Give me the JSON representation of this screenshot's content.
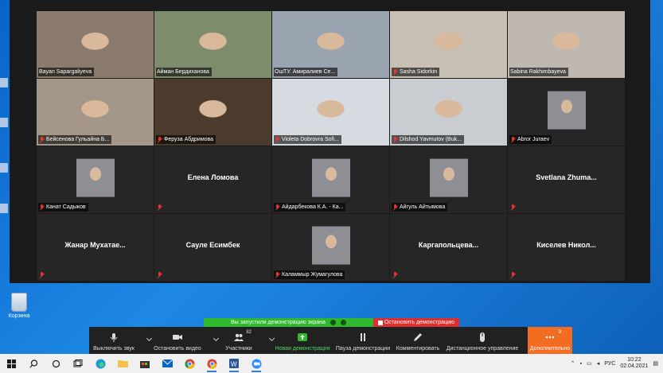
{
  "participants": [
    {
      "name": "Bayan Sapargaliyeva",
      "video": true,
      "muted": false,
      "active": true,
      "bg": "#8a7b6c"
    },
    {
      "name": "Айман Бердиханова",
      "video": true,
      "muted": false,
      "active": false,
      "bg": "#7d8c6a"
    },
    {
      "name": "OшТУ. Амиралиев Се...",
      "video": true,
      "muted": false,
      "active": false,
      "bg": "#9aa3b0"
    },
    {
      "name": "Sasha Sidorkin",
      "video": true,
      "muted": true,
      "active": false,
      "bg": "#c8c0b4"
    },
    {
      "name": "Sabina Rakhimbayeva",
      "video": true,
      "muted": false,
      "active": false,
      "bg": "#bfb8b0"
    },
    {
      "name": "Бейсенова Гульайна Б...",
      "video": true,
      "muted": true,
      "active": false,
      "bg": "#a49688"
    },
    {
      "name": "Феруза Абдримова",
      "video": true,
      "muted": true,
      "active": false,
      "bg": "#4a3b2c"
    },
    {
      "name": "Violeta Dobrovra Sofi...",
      "video": true,
      "muted": true,
      "active": false,
      "bg": "#d6dbe2"
    },
    {
      "name": "Dilshod Yavmutov (Buk...",
      "video": true,
      "muted": true,
      "active": false,
      "bg": "#c9ccd1"
    },
    {
      "name": "Abror Juraev",
      "video": true,
      "muted": true,
      "active": false,
      "bg": "#262626",
      "thumb": true
    },
    {
      "name": "Канат Садыков",
      "video": true,
      "muted": true,
      "active": false,
      "bg": "#262626",
      "thumb": true
    },
    {
      "name": "Елена Ломова",
      "video": false,
      "muted": true,
      "active": false
    },
    {
      "name": "Айдарбекова К.А. - Ка...",
      "video": true,
      "muted": true,
      "active": false,
      "bg": "#262626",
      "thumb": true
    },
    {
      "name": "Айгуль Айтымова",
      "video": true,
      "muted": true,
      "active": false,
      "bg": "#262626",
      "thumb": true
    },
    {
      "name": "Svetlana  Zhuma...",
      "video": false,
      "muted": true,
      "active": false
    },
    {
      "name": "Жанар  Мухатае...",
      "video": false,
      "muted": true,
      "active": false
    },
    {
      "name": "Сауле Есимбек",
      "video": false,
      "muted": true,
      "active": false
    },
    {
      "name": "Каламмыр Жумагулова",
      "video": true,
      "muted": true,
      "active": false,
      "bg": "#262626",
      "thumb": true
    },
    {
      "name": "Каргапольцева...",
      "video": false,
      "muted": true,
      "active": false
    },
    {
      "name": "Киселев  Никол...",
      "video": false,
      "muted": true,
      "active": false
    }
  ],
  "desktop": {
    "recycle_label": "Корзина"
  },
  "share_banner": {
    "status_text": "Вы запустили демонстрацию экрана",
    "stop_label": "Остановить демонстрацию"
  },
  "toolbar": {
    "mute_label": "Выключить звук",
    "video_label": "Остановить видео",
    "participants_label": "Участники",
    "participants_count": "82",
    "new_share_label": "Новая демонстрация",
    "pause_share_label": "Пауза демонстрации",
    "annotate_label": "Комментировать",
    "remote_label": "Дистанционное управление",
    "more_label": "Дополнительно",
    "more_count": "9"
  },
  "taskbar": {
    "language": "РУС",
    "time": "10:22",
    "date": "02.04.2021"
  },
  "colors": {
    "active_border": "#f3e97b",
    "share_green": "#2eb82e",
    "share_red": "#e02e2e",
    "more_orange": "#f26d21"
  }
}
